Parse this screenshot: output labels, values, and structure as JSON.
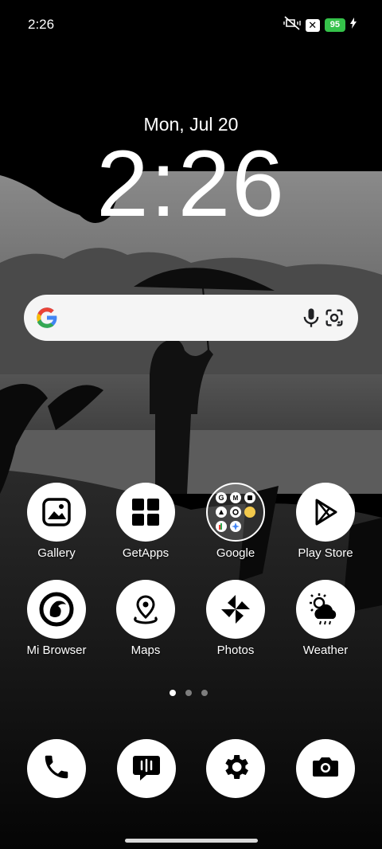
{
  "status": {
    "time": "2:26",
    "battery": "95",
    "icons": [
      "mute-vibrate-icon",
      "x-notification-icon",
      "battery-icon",
      "charging-bolt-icon"
    ]
  },
  "lock": {
    "date": "Mon, Jul 20",
    "clock": "2:26"
  },
  "search": {
    "icons": [
      "google-g-icon",
      "mic-icon",
      "lens-icon"
    ]
  },
  "apps": [
    {
      "label": "Gallery",
      "icon": "gallery-icon"
    },
    {
      "label": "GetApps",
      "icon": "getapps-icon"
    },
    {
      "label": "Google",
      "icon": "google-folder-icon"
    },
    {
      "label": "Play Store",
      "icon": "play-store-icon"
    },
    {
      "label": "Mi Browser",
      "icon": "mi-browser-icon"
    },
    {
      "label": "Maps",
      "icon": "maps-icon"
    },
    {
      "label": "Photos",
      "icon": "photos-icon"
    },
    {
      "label": "Weather",
      "icon": "weather-icon"
    }
  ],
  "dock": [
    {
      "icon": "phone-icon"
    },
    {
      "icon": "messages-icon"
    },
    {
      "icon": "settings-icon"
    },
    {
      "icon": "camera-icon"
    }
  ],
  "pages": {
    "count": 3,
    "active": 0
  }
}
